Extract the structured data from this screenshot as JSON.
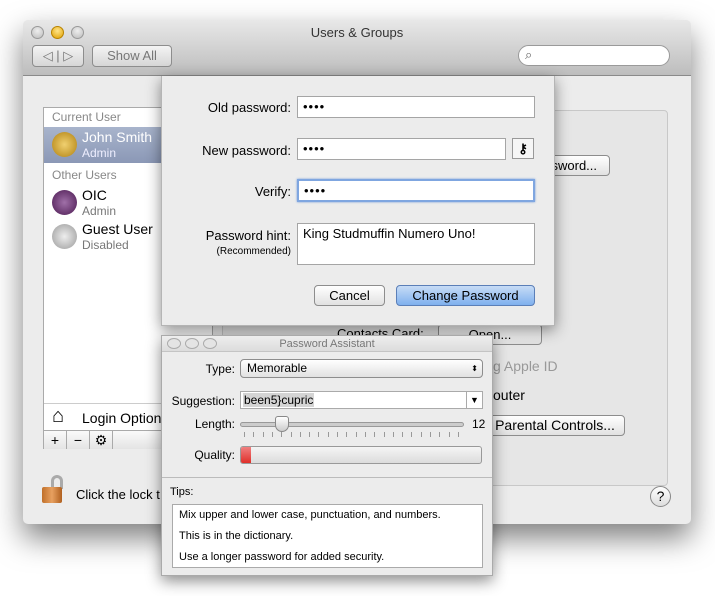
{
  "window": {
    "title": "Users & Groups",
    "show_all": "Show All",
    "search_placeholder": ""
  },
  "sidebar": {
    "current_user_header": "Current User",
    "current_user": {
      "name": "John Smith",
      "role": "Admin"
    },
    "other_users_header": "Other Users",
    "other_users": [
      {
        "name": "OIC",
        "role": "Admin"
      },
      {
        "name": "Guest User",
        "role": "Disabled"
      }
    ],
    "login_options": "Login Options",
    "add": "+",
    "remove": "−",
    "gear": "⚙"
  },
  "background_pane": {
    "change_password_btn": "Change Password...",
    "contacts_card_label": "Contacts Card:",
    "open_btn": "Open...",
    "apple_id_text": "g Apple ID",
    "computer_text": "outer",
    "parental_controls_btn": "Parental Controls..."
  },
  "footer": {
    "lock_text": "Click the lock t",
    "help": "?"
  },
  "sheet": {
    "old_password_label": "Old password:",
    "old_password_value": "••••",
    "new_password_label": "New password:",
    "new_password_value": "••••",
    "verify_label": "Verify:",
    "verify_value": "••••",
    "hint_label": "Password hint:",
    "hint_sub": "(Recommended)",
    "hint_value": "King Studmuffin Numero Uno!",
    "cancel": "Cancel",
    "change_password": "Change Password"
  },
  "assistant": {
    "title": "Password Assistant",
    "type_label": "Type:",
    "type_value": "Memorable",
    "suggestion_label": "Suggestion:",
    "suggestion_value": "been5}cupric",
    "length_label": "Length:",
    "length_value": "12",
    "quality_label": "Quality:",
    "quality_fraction": 0.04,
    "quality_color": "#e0302a",
    "tips_label": "Tips:",
    "tips": [
      "Mix upper and lower case, punctuation, and numbers.",
      "This is in the dictionary.",
      "Use a longer password for added security."
    ]
  }
}
